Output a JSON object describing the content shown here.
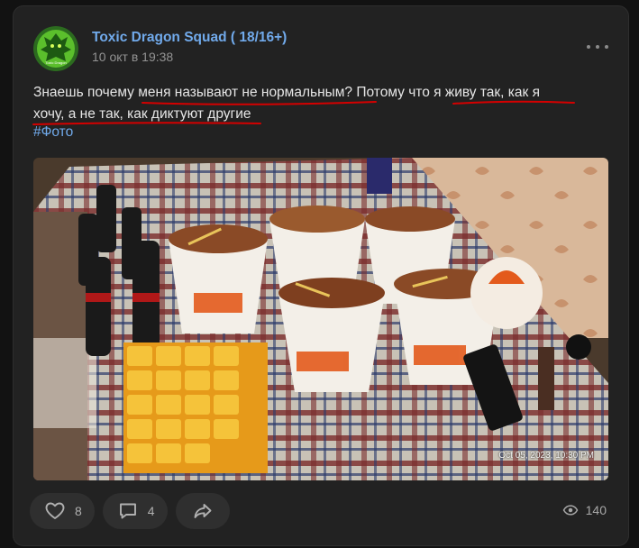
{
  "post": {
    "author": "Toxic Dragon Squad ( 18/16+)",
    "date": "10 окт в 19:38",
    "text_lines": [
      "Знаешь почему меня называют не нормальным? Потому что я живу так, как я",
      "хочу, а не так, как диктуют другие"
    ],
    "hashtag": "#Фото",
    "photo_timestamp": "Oct 05, 2023, 10:30 PM",
    "avatar_text": "Toxic Dragon"
  },
  "actions": {
    "likes": "8",
    "comments": "4",
    "views": "140"
  },
  "colors": {
    "background": "#121212",
    "card": "#222222",
    "link": "#71aaeb",
    "text": "#e6e6e6",
    "underline": "#d40000"
  }
}
